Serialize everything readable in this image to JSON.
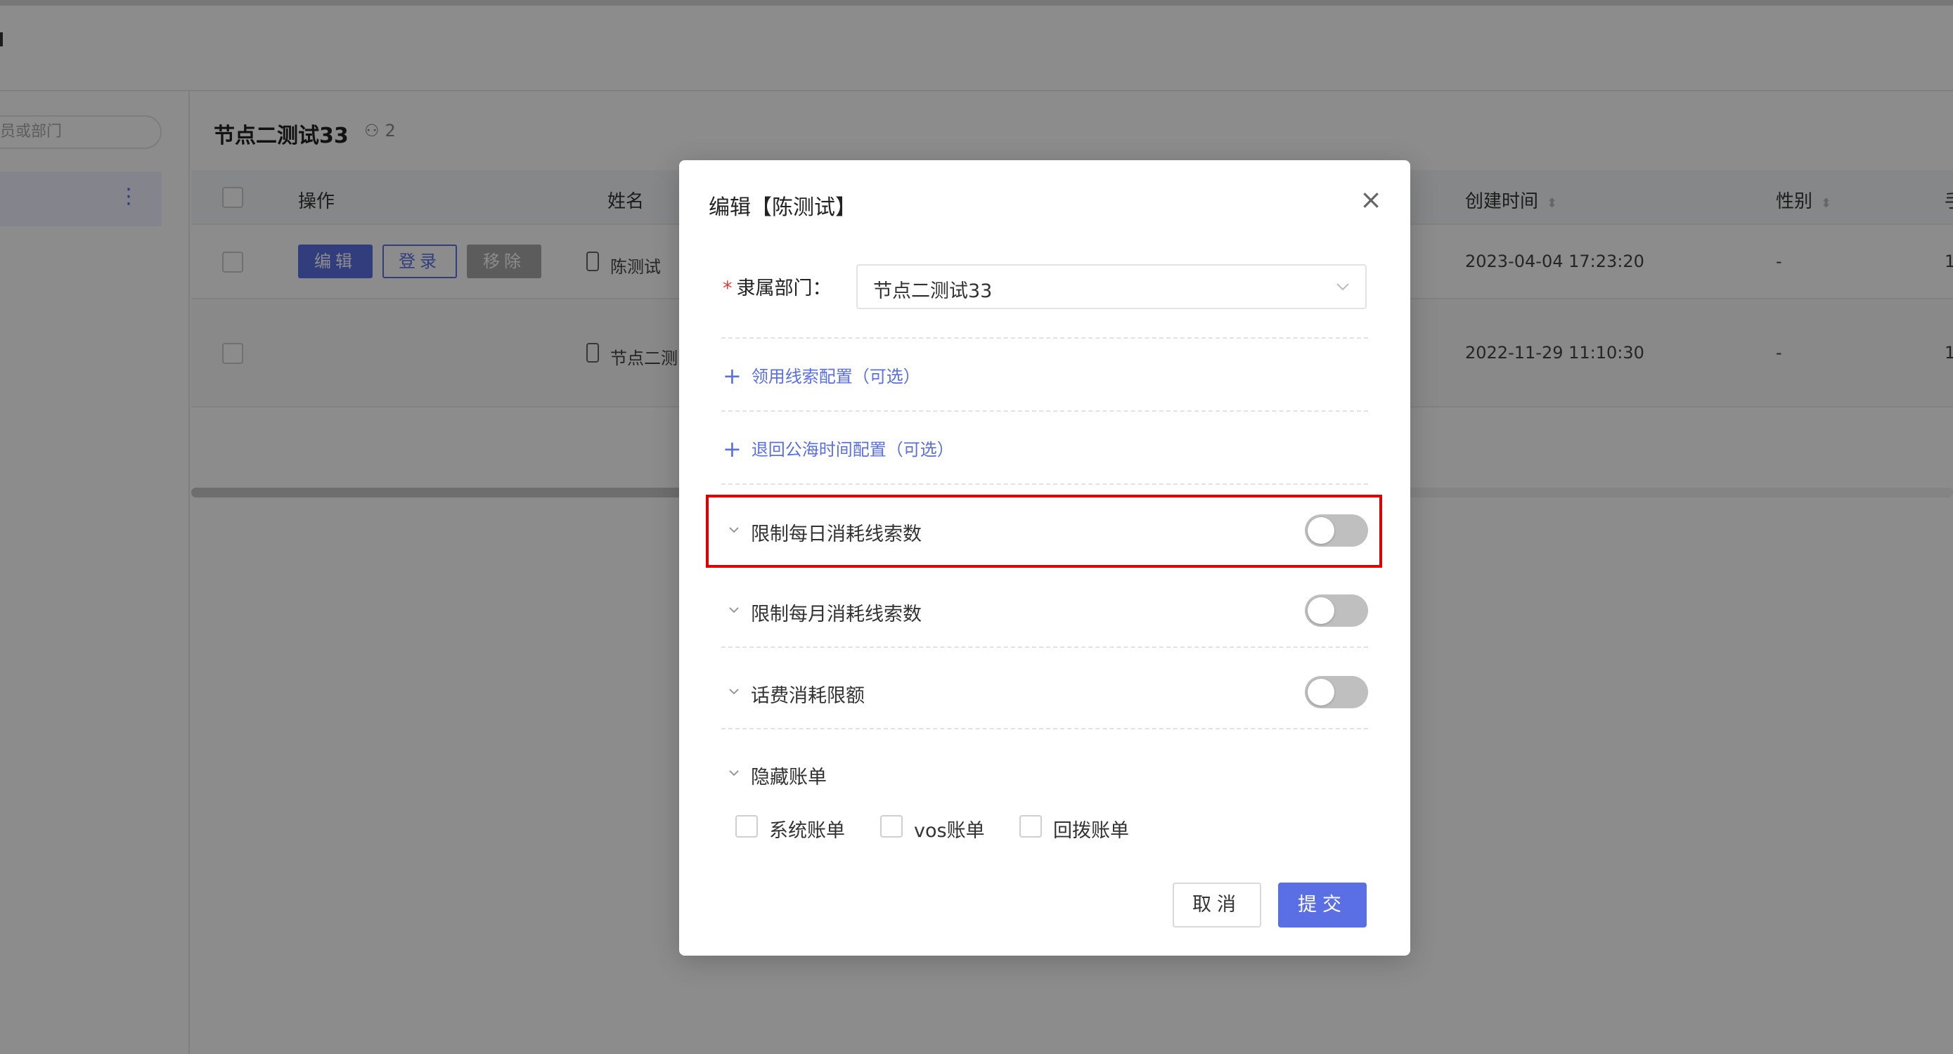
{
  "sidebar": {
    "search_placeholder": "员或部门"
  },
  "main": {
    "dept_title": "节点二测试33",
    "member_count": "2",
    "table": {
      "headers": {
        "operation": "操作",
        "name": "姓名",
        "created_time": "创建时间",
        "gender": "性别",
        "extra": "手"
      },
      "row_buttons": {
        "edit": "编辑",
        "login": "登录",
        "remove": "移除"
      },
      "rows": [
        {
          "name": "陈测试",
          "created_time": "2023-04-04 17:23:20",
          "gender": "-",
          "extra": "1"
        },
        {
          "name": "节点二测",
          "created_time": "2022-11-29 11:10:30",
          "gender": "-",
          "extra": "1"
        }
      ]
    }
  },
  "modal": {
    "title": "编辑【陈测试】",
    "dept_label": "隶属部门：",
    "dept_required_mark": "*",
    "dept_value": "节点二测试33",
    "links": [
      {
        "label": "领用线索配置（可选）"
      },
      {
        "label": "退回公海时间配置（可选）"
      }
    ],
    "toggles": [
      {
        "label": "限制每日消耗线索数",
        "on": false
      },
      {
        "label": "限制每月消耗线索数",
        "on": false
      },
      {
        "label": "话费消耗限额",
        "on": false
      }
    ],
    "hidden_bills": {
      "label": "隐藏账单",
      "options": [
        {
          "label": "系统账单",
          "checked": false
        },
        {
          "label": "vos账单",
          "checked": false
        },
        {
          "label": "回拨账单",
          "checked": false
        }
      ]
    },
    "cancel_label": "取消",
    "submit_label": "提交"
  },
  "colors": {
    "primary": "#5b6fe5",
    "highlight_border": "#e00000",
    "toggle_off": "#bfbfbf"
  }
}
